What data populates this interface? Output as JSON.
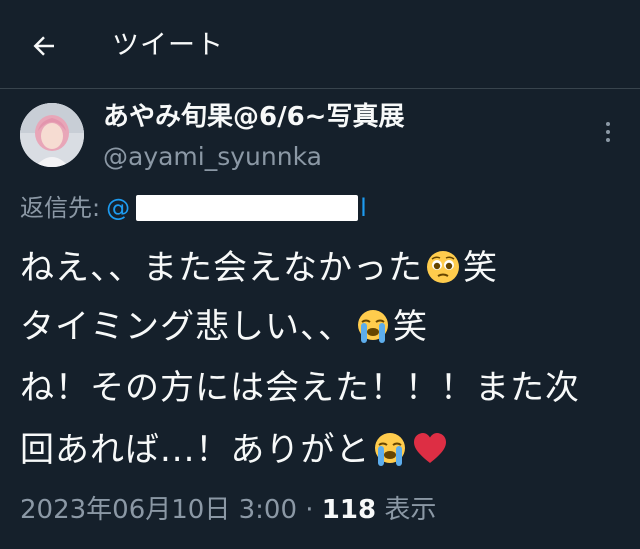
{
  "header": {
    "back_icon": "arrow-left-icon",
    "title": "ツイート"
  },
  "tweet": {
    "display_name": "あやみ旬果@6/6~写真展",
    "handle": "@ayami_syunnka",
    "more_icon": "more-vertical-icon",
    "reply_label": "返信先:",
    "reply_mention_prefix": "@",
    "reply_mention_suffix": "l",
    "lines": [
      {
        "text": "ねえ、、また会えなかった",
        "emoji": "pleading-face-icon",
        "tail": "笑"
      },
      {
        "text": "タイミング悲しい、、",
        "emoji": "loudly-crying-face-icon",
        "tail": "笑"
      },
      {
        "text": "ね！その方には会えた！！！また次",
        "emoji": "",
        "tail": ""
      },
      {
        "text": "回あれば...！ありがと",
        "emoji": "loudly-crying-face-icon",
        "emoji2": "red-heart-icon",
        "tail": ""
      }
    ],
    "timestamp": "2023年06月10日 3:00 · ",
    "views_count": "118",
    "views_label": " 表示"
  },
  "colors": {
    "background": "#15202b",
    "text_primary": "#f7f9f9",
    "text_secondary": "#8b98a5",
    "accent": "#1d9bf0",
    "divider": "#38444d"
  }
}
